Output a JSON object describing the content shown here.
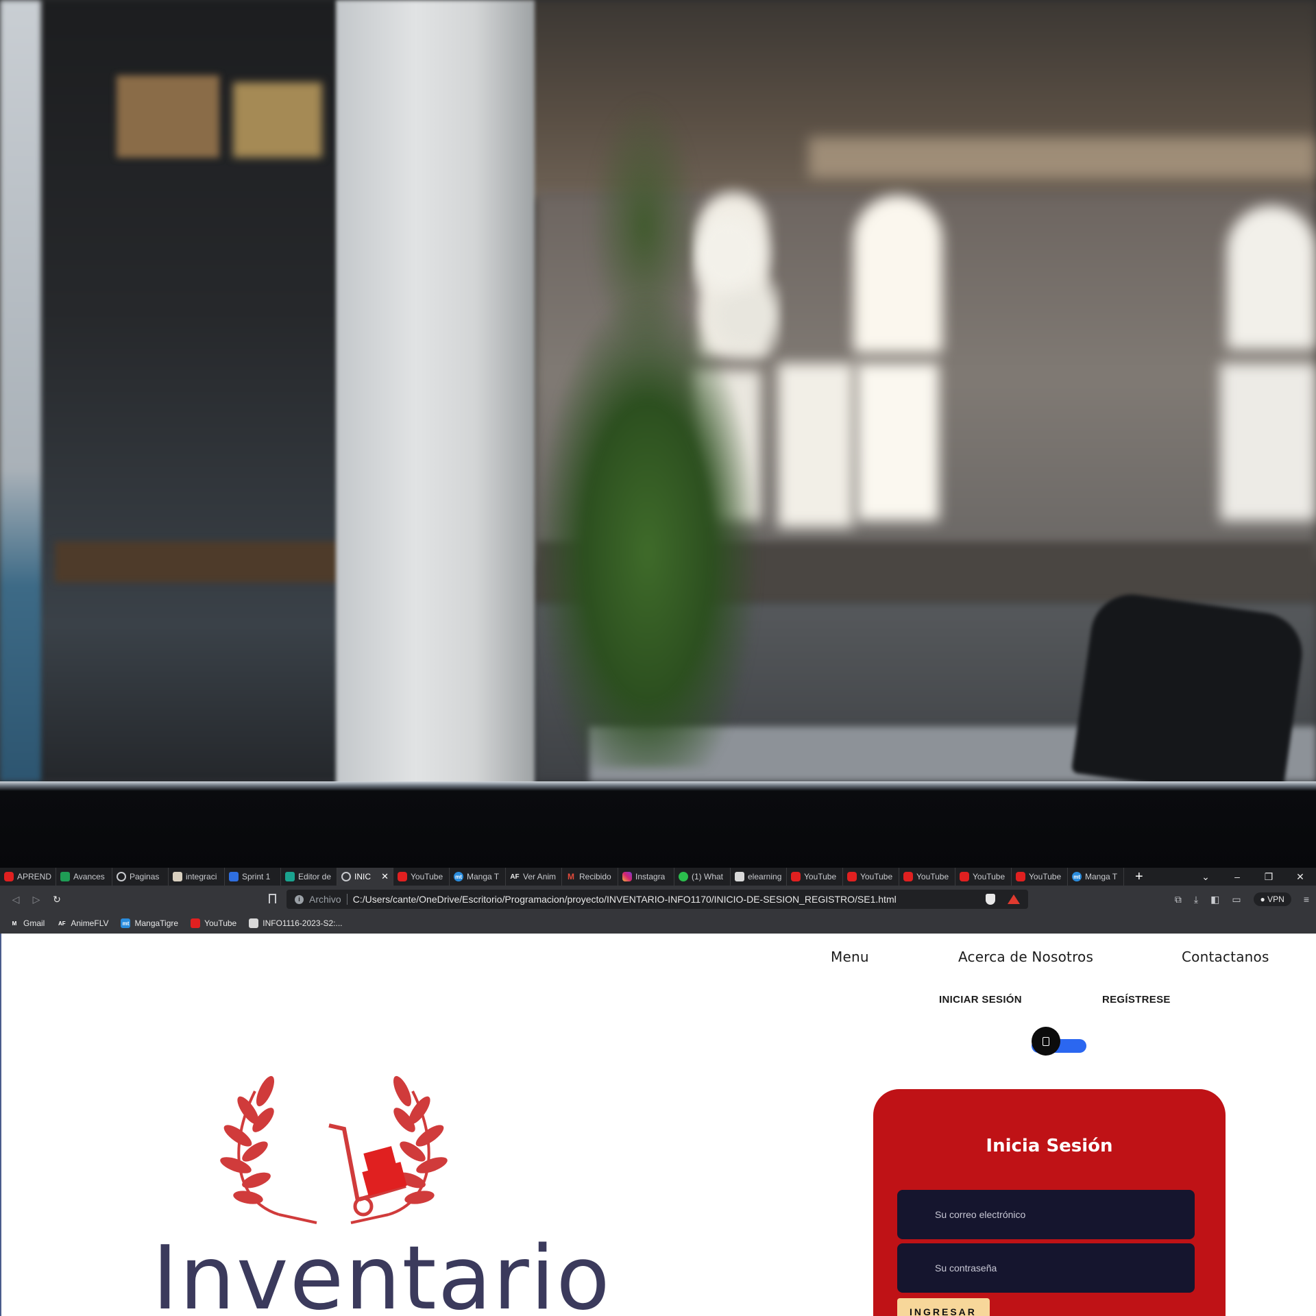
{
  "browser": {
    "tabs": [
      {
        "label": "APRENDI",
        "icon": "youtube-icon"
      },
      {
        "label": "Avances",
        "icon": "sheets-icon"
      },
      {
        "label": "Paginas",
        "icon": "globe-icon"
      },
      {
        "label": "integraci",
        "icon": "page-icon"
      },
      {
        "label": "Sprint 1",
        "icon": "docs-icon"
      },
      {
        "label": "Editor de",
        "icon": "editor-icon"
      },
      {
        "label": "INIC",
        "icon": "globe-icon",
        "active": true
      },
      {
        "label": "YouTube",
        "icon": "youtube-icon"
      },
      {
        "label": "Manga T",
        "icon": "mangatigre-icon"
      },
      {
        "label": "Ver Anim",
        "icon": "animeflv-icon"
      },
      {
        "label": "Recibido",
        "icon": "gmail-icon"
      },
      {
        "label": "Instagra",
        "icon": "instagram-icon"
      },
      {
        "label": "(1) What",
        "icon": "whatsapp-icon"
      },
      {
        "label": "elearning",
        "icon": "elearning-icon"
      },
      {
        "label": "YouTube",
        "icon": "youtube-icon"
      },
      {
        "label": "YouTube",
        "icon": "youtube-icon"
      },
      {
        "label": "YouTube",
        "icon": "youtube-icon"
      },
      {
        "label": "YouTube",
        "icon": "youtube-icon"
      },
      {
        "label": "YouTube",
        "icon": "youtube-icon"
      },
      {
        "label": "Manga T",
        "icon": "mangatigre-icon"
      }
    ],
    "new_tab": "+",
    "window_controls": {
      "tabs_menu": "⌄",
      "minimize": "–",
      "restore": "❐",
      "close": "✕"
    },
    "address": {
      "scheme_label": "Archivo",
      "url": "C:/Users/cante/OneDrive/Escritorio/Programacion/proyecto/INVENTARIO-INFO1170/INICIO-DE-SESION_REGISTRO/SE1.html"
    },
    "vpn_label": "VPN",
    "bookmarks": [
      {
        "label": "Gmail",
        "icon": "gmail-icon"
      },
      {
        "label": "AnimeFLV",
        "icon": "animeflv-icon"
      },
      {
        "label": "MangaTigre",
        "icon": "mangatigre-icon"
      },
      {
        "label": "YouTube",
        "icon": "youtube-icon"
      },
      {
        "label": "INFO1116-2023-S2:...",
        "icon": "elearning-icon"
      }
    ]
  },
  "page": {
    "nav": {
      "menu": "Menu",
      "about": "Acerca de Nosotros",
      "contact": "Contactanos"
    },
    "auth_tabs": {
      "login": "INICIAR SESIÓN",
      "register": "REGÍSTRESE"
    },
    "logo_text": "Inventario",
    "login_card": {
      "title": "Inicia Sesión",
      "email_placeholder": "Su correo electrónico",
      "password_placeholder": "Su contraseña",
      "submit_label": "INGRESAR"
    }
  },
  "colors": {
    "card_bg": "#bf1216",
    "field_bg": "#15152e",
    "button_bg": "#f7d79a",
    "toggle_track": "#2b67f0",
    "logo_text": "#3b3a5c",
    "logo_red": "#d03b3b"
  }
}
